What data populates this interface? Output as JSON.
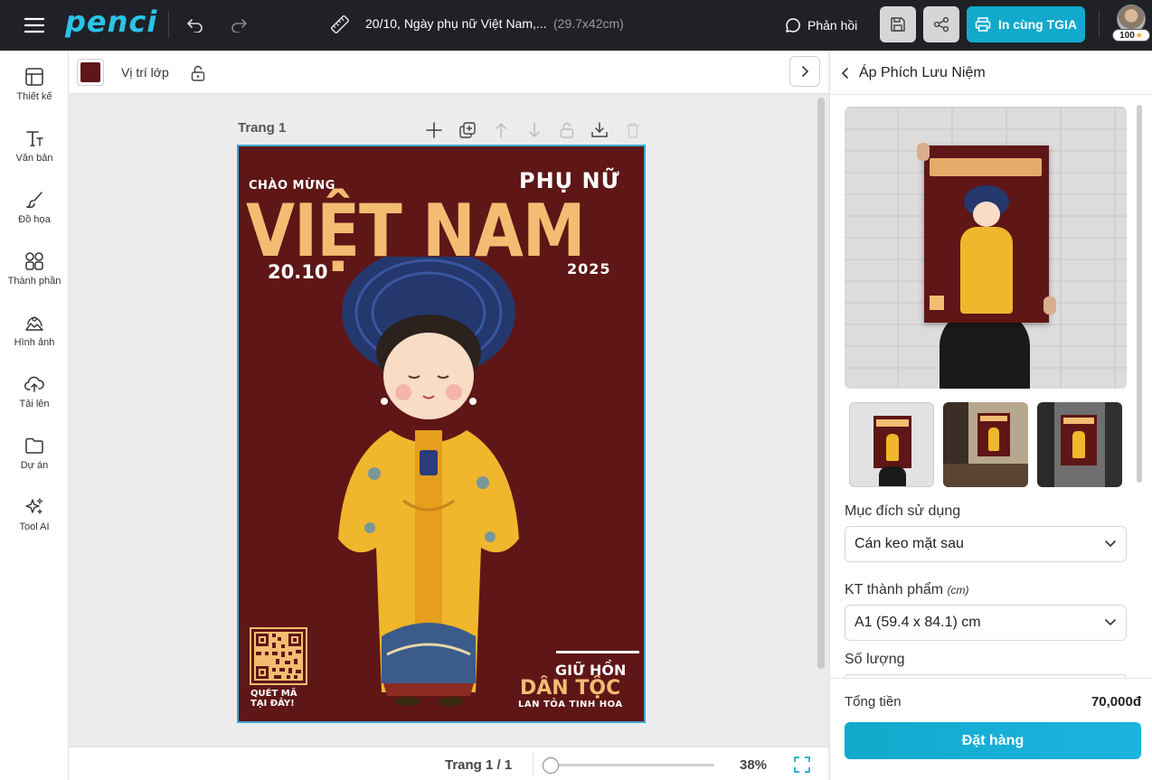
{
  "app": {
    "logo": "penci"
  },
  "topbar": {
    "doc_title": "20/10, Ngày phụ nữ Việt Nam,...",
    "doc_size": "(29.7x42cm)",
    "feedback_label": "Phản hồi",
    "print_label": "In cùng TGIA",
    "avatar_badge": "100"
  },
  "sidebar": {
    "items": [
      {
        "label": "Thiết kế",
        "icon": "layout-icon"
      },
      {
        "label": "Văn bản",
        "icon": "text-icon"
      },
      {
        "label": "Đồ họa",
        "icon": "brush-icon"
      },
      {
        "label": "Thành phần",
        "icon": "shapes-icon"
      },
      {
        "label": "Hình ảnh",
        "icon": "image-icon"
      },
      {
        "label": "Tải lên",
        "icon": "upload-cloud-icon"
      },
      {
        "label": "Dự án",
        "icon": "folder-icon"
      },
      {
        "label": "Tool AI",
        "icon": "sparkles-icon"
      }
    ]
  },
  "context_bar": {
    "color_swatch": "#5f1616",
    "layer_label": "Vị trí lớp"
  },
  "canvas": {
    "page_label": "Trang 1"
  },
  "poster": {
    "chao_mung": "CHÀO MỪNG",
    "phu_nu": "PHỤ NỮ",
    "viet_nam": "VIỆT NAM",
    "date": "20.10",
    "year": "2025",
    "qr_line1": "QUÉT MÃ",
    "qr_line2": "TẠI ĐÂY!",
    "giu_hon": "GIỮ HỒN",
    "dan_toc": "DÂN TỘC",
    "lan_toa": "LAN TỎA TINH HOA"
  },
  "bottom_bar": {
    "page_indicator": "Trang 1 / 1",
    "zoom": "38%",
    "zoom_value": 0.38
  },
  "panel": {
    "title": "Áp Phích Lưu Niệm",
    "purpose_label": "Mục đích sử dụng",
    "purpose_value": "Cán keo mặt sau",
    "size_label": "KT thành phẩm",
    "size_unit": "(cm)",
    "size_value": "A1 (59.4 x 84.1) cm",
    "qty_label": "Số lượng",
    "total_label": "Tổng tiền",
    "total_value": "70,000đ",
    "order_label": "Đặt hàng"
  },
  "colors": {
    "topbar_bg": "#1f2126",
    "accent": "#12a9cc",
    "poster_bg": "#5f1616",
    "poster_title": "#f2bd72"
  }
}
